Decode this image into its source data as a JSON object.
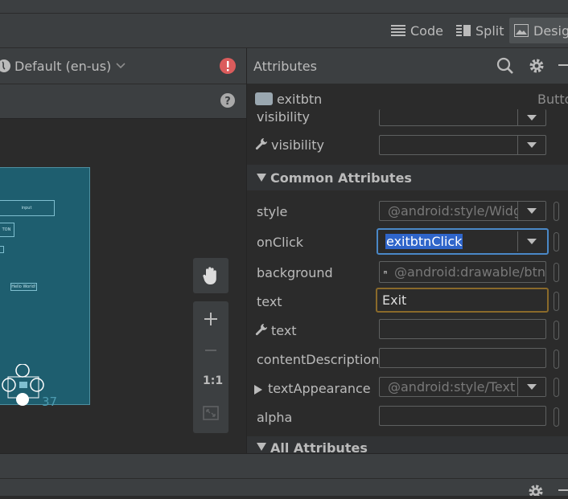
{
  "view_modes": {
    "code": "Code",
    "split": "Split",
    "design": "Desig"
  },
  "design_toolbar": {
    "locale": "Default (en-us)"
  },
  "canvas": {
    "widgets": {
      "input": "input",
      "button": "TON",
      "textview": "Hello World!",
      "clock": "37"
    }
  },
  "zoom": {
    "one_to_one": "1:1"
  },
  "attributes": {
    "title": "Attributes",
    "component_name": "exitbtn",
    "component_type": "Butto",
    "rows_top": {
      "visibility": "visibility",
      "tools_visibility": "visibility"
    },
    "common_section": "Common Attributes",
    "common": [
      {
        "label": "style",
        "value": "@android:style/Widg"
      },
      {
        "label": "onClick",
        "value": "exitbtnClick"
      },
      {
        "label": "background",
        "value": "@android:drawable/btn"
      },
      {
        "label": "text",
        "value": "Exit"
      },
      {
        "label": "text",
        "value": ""
      },
      {
        "label": "contentDescription",
        "value": ""
      },
      {
        "label": "textAppearance",
        "value": "@android:style/Text"
      },
      {
        "label": "alpha",
        "value": ""
      }
    ],
    "all_section": "All Attributes"
  },
  "colors": {
    "accent_blue": "#4a88c7",
    "focus_orange": "#8a6a2a",
    "canvas": "#1e5e6f",
    "error_red": "#db5c5c"
  }
}
